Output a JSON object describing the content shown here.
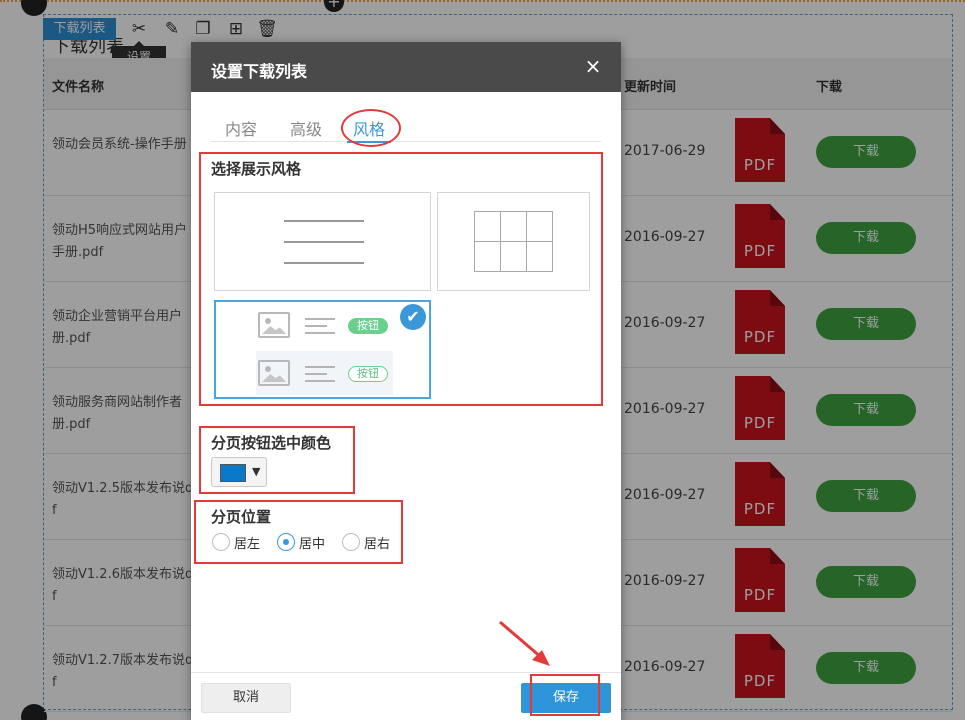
{
  "background": {
    "module_tag": "下载列表",
    "ghost_title": "下载列表",
    "tooltip": "设置",
    "table": {
      "headers": {
        "name": "文件名称",
        "date": "更新时间",
        "download": "下载"
      },
      "rows": [
        {
          "name": "领动会员系统-操作手册",
          "date": "2017-06-29",
          "pdf": "PDF",
          "button": "下载"
        },
        {
          "name": "领动H5响应式网站用户手册.pdf",
          "date": "2016-09-27",
          "pdf": "PDF",
          "button": "下载"
        },
        {
          "name": "领动企业营销平台用户册.pdf",
          "date": "2016-09-27",
          "pdf": "PDF",
          "button": "下载"
        },
        {
          "name": "领动服务商网站制作者册.pdf",
          "date": "2016-09-27",
          "pdf": "PDF",
          "button": "下载"
        },
        {
          "name": "领动V1.2.5版本发布说df",
          "date": "2016-09-27",
          "pdf": "PDF",
          "button": "下载"
        },
        {
          "name": "领动V1.2.6版本发布说df",
          "date": "2016-09-27",
          "pdf": "PDF",
          "button": "下载"
        },
        {
          "name": "领动V1.2.7版本发布说df",
          "date": "2016-09-27",
          "pdf": "PDF",
          "button": "下载"
        }
      ]
    },
    "toolbar_icons": [
      "settings-tools-icon",
      "edit-icon",
      "copy-icon",
      "grid-icon",
      "delete-icon"
    ]
  },
  "dialog": {
    "title": "设置下载列表",
    "close": "×",
    "tabs": [
      {
        "label": "内容",
        "active": false
      },
      {
        "label": "高级",
        "active": false
      },
      {
        "label": "风格",
        "active": true
      }
    ],
    "style_section": {
      "label": "选择展示风格",
      "options": [
        {
          "name": "list-style",
          "selected": false
        },
        {
          "name": "grid-style",
          "selected": false
        },
        {
          "name": "image-text-button-style",
          "selected": true,
          "button_text": "按钮"
        }
      ]
    },
    "color_section": {
      "label": "分页按钮选中颜色",
      "color": "#0a78c8",
      "caret": "▼"
    },
    "position_section": {
      "label": "分页位置",
      "options": [
        {
          "label": "居左",
          "checked": false
        },
        {
          "label": "居中",
          "checked": true
        },
        {
          "label": "居右",
          "checked": false
        }
      ]
    },
    "footer": {
      "cancel": "取消",
      "save": "保存"
    }
  },
  "colors": {
    "accent": "#3b98d8",
    "annotation": "#e53a3a",
    "download_button": "#3ea440",
    "pdf_icon": "#c8141e"
  }
}
